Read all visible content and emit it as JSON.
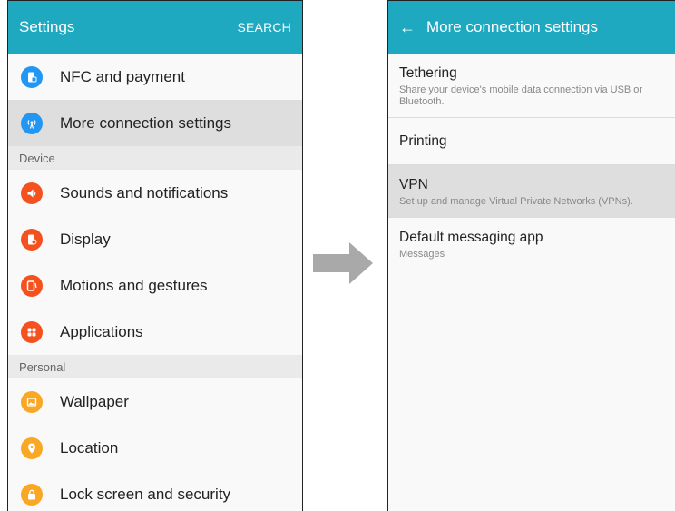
{
  "left": {
    "title": "Settings",
    "action": "SEARCH",
    "items_top": [
      {
        "label": "NFC and payment"
      },
      {
        "label": "More connection settings"
      }
    ],
    "section_device": "Device",
    "items_device": [
      {
        "label": "Sounds and notifications"
      },
      {
        "label": "Display"
      },
      {
        "label": "Motions and gestures"
      },
      {
        "label": "Applications"
      }
    ],
    "section_personal": "Personal",
    "items_personal": [
      {
        "label": "Wallpaper"
      },
      {
        "label": "Location"
      },
      {
        "label": "Lock screen and security"
      }
    ]
  },
  "right": {
    "title": "More connection settings",
    "settings": [
      {
        "title": "Tethering",
        "desc": "Share your device's mobile data connection via USB or Bluetooth."
      },
      {
        "title": "Printing"
      },
      {
        "title": "VPN",
        "desc": "Set up and manage Virtual Private Networks (VPNs)."
      },
      {
        "title": "Default messaging app",
        "desc": "Messages"
      }
    ]
  },
  "colors": {
    "appbar": "#1ea9c1",
    "icon_blue": "#2196f3",
    "icon_orange": "#f4511e",
    "icon_amber": "#f9a825",
    "arrow": "#a9a9a9"
  }
}
